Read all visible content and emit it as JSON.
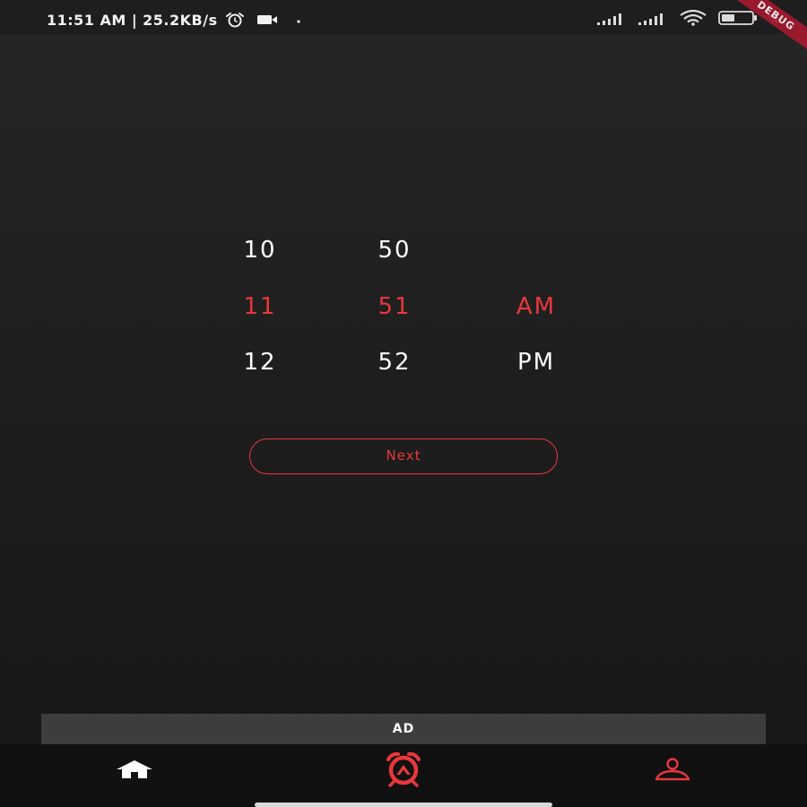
{
  "status_bar": {
    "time": "11:51 AM",
    "separator": "|",
    "network_speed": "25.2KB/s",
    "battery_percent": "%",
    "icons": [
      "alarm-icon",
      "video-icon",
      "signal-icon",
      "signal-icon",
      "wifi-icon",
      "battery-icon"
    ],
    "debug_label": "DEBUG"
  },
  "time_picker": {
    "hours": [
      "10",
      "11",
      "12"
    ],
    "minutes": [
      "50",
      "51",
      "52"
    ],
    "periods": [
      "AM",
      "PM"
    ],
    "selected": {
      "hour": "11",
      "minute": "51",
      "period": "AM"
    }
  },
  "next_button": {
    "label": "Next"
  },
  "ad": {
    "label": "AD"
  },
  "bottom_nav": {
    "items": [
      {
        "icon": "home-icon",
        "active": false
      },
      {
        "icon": "alarm-icon",
        "active": true
      },
      {
        "icon": "profile-icon",
        "active": false
      }
    ]
  },
  "colors": {
    "accent": "#e8373c",
    "background": "#1f1f1f",
    "text": "#ffffff",
    "ad_background": "#3d3d3d",
    "nav_background": "#111111"
  }
}
